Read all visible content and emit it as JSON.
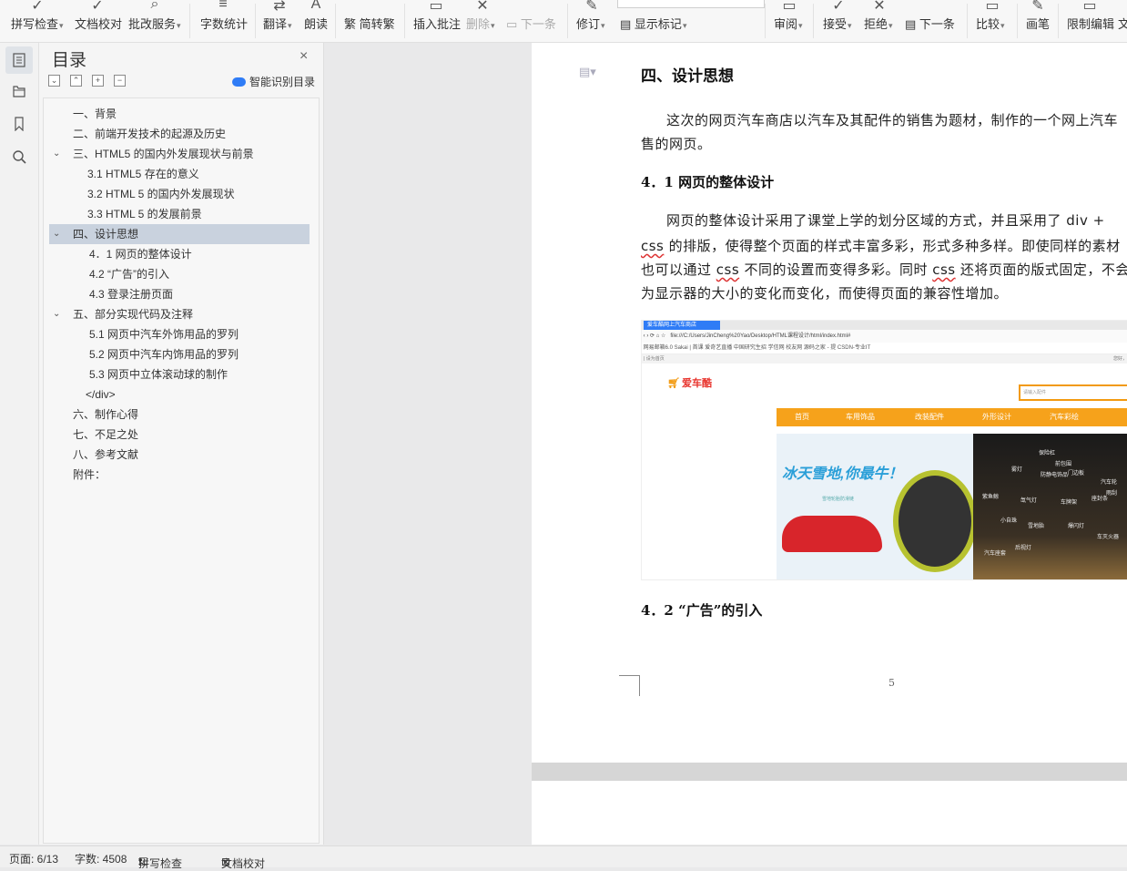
{
  "ribbon": {
    "items": [
      {
        "label": "拼写检查",
        "caret": true,
        "icon": "✓",
        "disabled": false
      },
      {
        "label": "文档校对",
        "caret": false,
        "icon": "✓",
        "disabled": false
      },
      {
        "label": "批改服务",
        "caret": true,
        "icon": "⌕",
        "disabled": false
      },
      {
        "label": "字数统计",
        "caret": false,
        "icon": "≡",
        "disabled": false
      },
      {
        "label": "翻译",
        "caret": true,
        "icon": "⇄",
        "disabled": false
      },
      {
        "label": "朗读",
        "caret": false,
        "icon": "A",
        "disabled": false
      },
      {
        "label": "简转繁",
        "caret": false,
        "icon": "繁",
        "disabled": false
      },
      {
        "label": "插入批注",
        "caret": false,
        "icon": "▭",
        "disabled": false
      },
      {
        "label": "删除",
        "caret": true,
        "icon": "✕",
        "disabled": true
      },
      {
        "label": "下一条",
        "caret": false,
        "icon": "▭",
        "disabled": true
      },
      {
        "label": "修订",
        "caret": true,
        "icon": "✎",
        "disabled": false
      },
      {
        "label": "显示标记",
        "caret": true,
        "icon": "▤",
        "disabled": false
      },
      {
        "label": "审阅",
        "caret": true,
        "icon": "▭",
        "disabled": false
      },
      {
        "label": "接受",
        "caret": true,
        "icon": "✓",
        "disabled": false
      },
      {
        "label": "拒绝",
        "caret": true,
        "icon": "✕",
        "disabled": false
      },
      {
        "label": "下一条",
        "caret": false,
        "icon": "▤",
        "disabled": false
      },
      {
        "label": "比较",
        "caret": true,
        "icon": "▭",
        "disabled": false
      },
      {
        "label": "画笔",
        "caret": false,
        "icon": "✎",
        "disabled": false
      },
      {
        "label": "限制编辑",
        "caret": false,
        "icon": "▭",
        "disabled": false
      },
      {
        "label": "文",
        "caret": false,
        "icon": "",
        "disabled": false
      }
    ]
  },
  "icon_strip": [
    {
      "icon": "toc-icon",
      "glyph": "☰",
      "active": true
    },
    {
      "icon": "folder-icon",
      "glyph": "▭",
      "active": false
    },
    {
      "icon": "bookmark-icon",
      "glyph": "⌑",
      "active": false
    },
    {
      "icon": "search-icon",
      "glyph": "⌕",
      "active": false
    }
  ],
  "toc": {
    "title": "目录",
    "close": "×",
    "controls": [
      "⌄",
      "⌃",
      "+",
      "−"
    ],
    "smart_button": "智能识别目录",
    "items": [
      {
        "text": "一、背景",
        "level": 1,
        "chevron": "",
        "selected": false
      },
      {
        "text": "二、前端开发技术的起源及历史",
        "level": 1,
        "chevron": "",
        "selected": false
      },
      {
        "text": "三、HTML5 的国内外发展现状与前景",
        "level": 1,
        "chevron": "⌄",
        "selected": false
      },
      {
        "text": "3.1    HTML5 存在的意义",
        "level": 2,
        "chevron": "",
        "selected": false
      },
      {
        "text": "3.2    HTML 5 的国内外发展现状",
        "level": 2,
        "chevron": "",
        "selected": false
      },
      {
        "text": "3.3    HTML 5 的发展前景",
        "level": 2,
        "chevron": "",
        "selected": false
      },
      {
        "text": "四、设计思想",
        "level": 1,
        "chevron": "⌄",
        "selected": true
      },
      {
        "text": "4．1    网页的整体设计",
        "level": 3,
        "chevron": "",
        "selected": false
      },
      {
        "text": "4.2     “广告”的引入",
        "level": 3,
        "chevron": "",
        "selected": false
      },
      {
        "text": "4.3     登录注册页面",
        "level": 3,
        "chevron": "",
        "selected": false
      },
      {
        "text": "五、部分实现代码及注释",
        "level": 1,
        "chevron": "⌄",
        "selected": false
      },
      {
        "text": "5.1 网页中汽车外饰用品的罗列",
        "level": 3,
        "chevron": "",
        "selected": false
      },
      {
        "text": "5.2 网页中汽车内饰用品的罗列",
        "level": 3,
        "chevron": "",
        "selected": false
      },
      {
        "text": "5.3 网页中立体滚动球的制作",
        "level": 3,
        "chevron": "",
        "selected": false
      },
      {
        "text": "</div>",
        "level": 4,
        "chevron": "",
        "selected": false
      },
      {
        "text": "六、制作心得",
        "level": 1,
        "chevron": "",
        "selected": false
      },
      {
        "text": "七、不足之处",
        "level": 1,
        "chevron": "",
        "selected": false
      },
      {
        "text": "八、参考文献",
        "level": 1,
        "chevron": "",
        "selected": false
      },
      {
        "text": "附件：",
        "level": 1,
        "chevron": "",
        "selected": false
      }
    ]
  },
  "document": {
    "heading": "四、设计思想",
    "intro_line1": "这次的网页汽车商店以汽车及其配件的销售为题材，制作的一个网上汽车",
    "intro_line2": "售的网页。",
    "sub1": "4．1   网页的整体设计",
    "para_line1": "网页的整体设计采用了课堂上学的划分区域的方式，并且采用了 div  +",
    "para_line2_a": "css",
    "para_line2_b": "  的排版，使得整个页面的样式丰富多彩，形式多种多样。即使同样的素材",
    "para_line3_a": "也可以通过 ",
    "para_line3_css": "css",
    "para_line3_b": " 不同的设置而变得多彩。同时 ",
    "para_line3_css2": "css",
    "para_line3_c": " 还将页面的版式固定，不会",
    "para_line4": "为显示器的大小的变化而变化，而使得页面的兼容性增加。",
    "sub2": "4．2   “广告”的引入",
    "page_number": "5",
    "screenshot": {
      "tab_title": "爱车酷网上汽车商店",
      "url": "file:///C:/Users/JinCheng%20Yao/Desktop/HTML课程设计/html/index.html#",
      "bookmarks": "网易邮箱6.0   Sakai | 首课   爱奇艺直播   中国研究生招   学信网   校友网   源码之家 - 提   CSDN-专业IT",
      "site_bar_left": "| 设为首页",
      "site_bar_right": "您好，欢",
      "logo_text": "爱车酷",
      "search_placeholder": "请输入配件",
      "nav": [
        "首页",
        "车用饰品",
        "改装配件",
        "外形设计",
        "汽车彩绘"
      ],
      "slogan": "冰天雪地,你最牛！",
      "slogan_sub": "雪地轮胎防滑链",
      "tags": [
        "保险杠",
        "前包围",
        "防静电饰品",
        "门边板",
        "雾灯",
        "汽车轮",
        "雨刮",
        "紫鱼鲸",
        "氙气灯",
        "车牌架",
        "座封条",
        "小自珠",
        "雪地胎",
        "爆闪灯",
        "车灭火器",
        "后视灯",
        "汽车座套"
      ]
    }
  },
  "status_bar": {
    "page": "页面: 6/13",
    "words": "字数: 4508",
    "spell_check": "拼写检查",
    "doc_check": "文档校对"
  }
}
